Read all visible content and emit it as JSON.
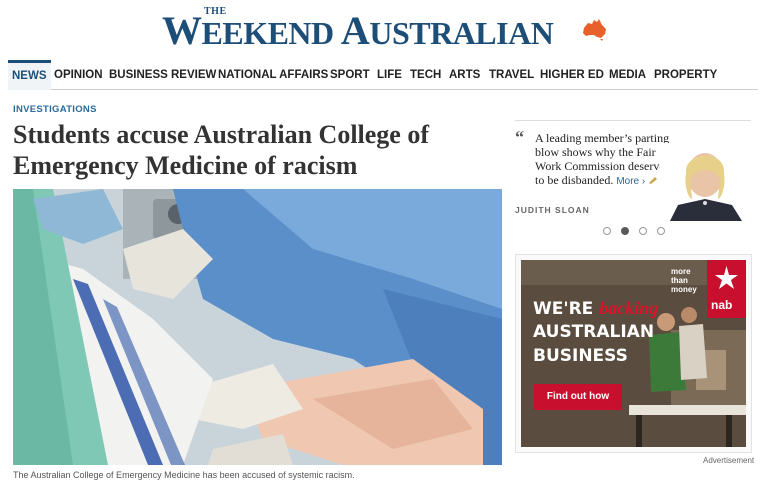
{
  "masthead": {
    "the": "THE",
    "name": "Weekend Australian"
  },
  "nav": {
    "items": [
      {
        "label": "NEWS",
        "active": true
      },
      {
        "label": "OPINION"
      },
      {
        "label": "BUSINESS REVIEW"
      },
      {
        "label": "NATIONAL AFFAIRS"
      },
      {
        "label": "SPORT"
      },
      {
        "label": "LIFE"
      },
      {
        "label": "TECH"
      },
      {
        "label": "ARTS"
      },
      {
        "label": "TRAVEL"
      },
      {
        "label": "HIGHER ED"
      },
      {
        "label": "MEDIA"
      },
      {
        "label": "PROPERTY"
      }
    ]
  },
  "article": {
    "kicker": "INVESTIGATIONS",
    "headline": "Students accuse Australian College of Emergency Medicine of racism",
    "caption": "The Australian College of Emergency Medicine has been accused of systemic racism."
  },
  "commentary": {
    "quote": "A leading member’s parting blow shows why the Fair Work Commission deserves to be disbanded.",
    "more": "More ›",
    "author": "JUDITH SLOAN",
    "carousel_active_index": 1,
    "carousel_count": 4
  },
  "ad": {
    "line1_prefix": "WE'RE ",
    "line1_accent": "backing",
    "line2": "AUSTRALIAN",
    "line3": "BUSINESS",
    "tagline": "more than money",
    "brand": "nab",
    "cta": "Find out how",
    "label": "Advertisement"
  },
  "colors": {
    "brand_blue": "#1d4e77",
    "logo_orange": "#e8612c",
    "nab_red": "#c8102e",
    "link_blue": "#2a6a9a"
  }
}
